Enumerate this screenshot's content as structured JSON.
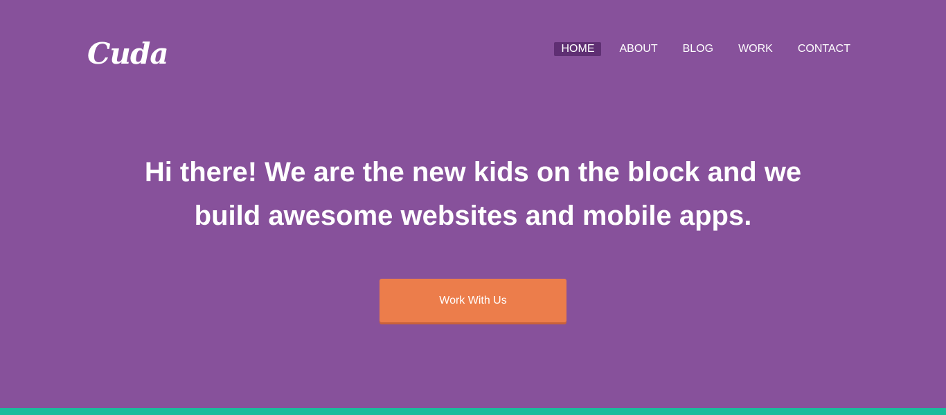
{
  "colors": {
    "background": "#87519b",
    "nav_active": "#5f2f73",
    "cta": "#ec7d4b",
    "bottom_strip": "#1abc9c",
    "text": "#ffffff"
  },
  "header": {
    "logo_text": "Cuda",
    "nav": [
      {
        "label": "HOME",
        "active": true
      },
      {
        "label": "ABOUT",
        "active": false
      },
      {
        "label": "BLOG",
        "active": false
      },
      {
        "label": "WORK",
        "active": false
      },
      {
        "label": "CONTACT",
        "active": false
      }
    ]
  },
  "hero": {
    "title_line_1": "Hi there! We are the new kids on the block and we",
    "title_line_2": "build awesome websites and mobile apps.",
    "cta_label": "Work With Us"
  }
}
